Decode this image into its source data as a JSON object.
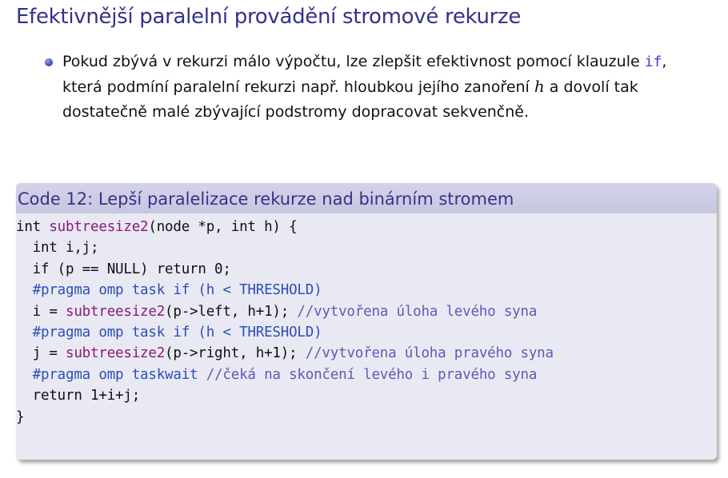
{
  "slide": {
    "title": "Efektivnější paralelní provádění stromové rekurze"
  },
  "bullet": {
    "text_1": "Pokud zbývá v rekurzi málo výpočtu, lze zlepšit efektivnost pomocí klauzule ",
    "code": "if",
    "text_2": ", která podmíní paralelní rekurzi např. hloubkou jejího zanoření ",
    "math": "h",
    "text_3": " a dovolí tak dostatečně malé zbývající podstromy dopracovat sekvenčně."
  },
  "code_block": {
    "caption": "Code 12: Lepší paralelizace rekurze nad binárním stromem",
    "lines": [
      [
        {
          "t": "int ",
          "c": "kw"
        },
        {
          "t": "subtreesize2",
          "c": "fn"
        },
        {
          "t": "(node *p, int h) {",
          "c": "kw"
        }
      ],
      [
        {
          "t": "  int i,j;",
          "c": "kw"
        }
      ],
      [
        {
          "t": "  if (p == NULL) return 0;",
          "c": "kw"
        }
      ],
      [
        {
          "t": "  #pragma omp task if (h < THRESHOLD)",
          "c": "pp"
        }
      ],
      [
        {
          "t": "  i = ",
          "c": "kw"
        },
        {
          "t": "subtreesize2",
          "c": "fn"
        },
        {
          "t": "(p->left, h+1); ",
          "c": "kw"
        },
        {
          "t": "//vytvořena úloha levého syna",
          "c": "cm"
        }
      ],
      [
        {
          "t": "  #pragma omp task if (h < THRESHOLD)",
          "c": "pp"
        }
      ],
      [
        {
          "t": "  j = ",
          "c": "kw"
        },
        {
          "t": "subtreesize2",
          "c": "fn"
        },
        {
          "t": "(p->right, h+1); ",
          "c": "kw"
        },
        {
          "t": "//vytvořena úloha pravého syna",
          "c": "cm"
        }
      ],
      [
        {
          "t": "  #pragma omp taskwait ",
          "c": "pp"
        },
        {
          "t": "//čeká na skončení levého i pravého syna",
          "c": "cm"
        }
      ],
      [
        {
          "t": "  return 1+i+j;",
          "c": "kw"
        }
      ],
      [
        {
          "t": "}",
          "c": "kw"
        }
      ]
    ]
  },
  "colors": {
    "title": "#33338a",
    "bullet": "#4b52c6",
    "code_background": "#e9e9f3",
    "code_header_background": "#c6c6e0",
    "function_name": "#8a1a7a",
    "preprocessor": "#2b4fb8",
    "comment": "#5b5bb8",
    "inline_code": "#3b3bd6"
  }
}
